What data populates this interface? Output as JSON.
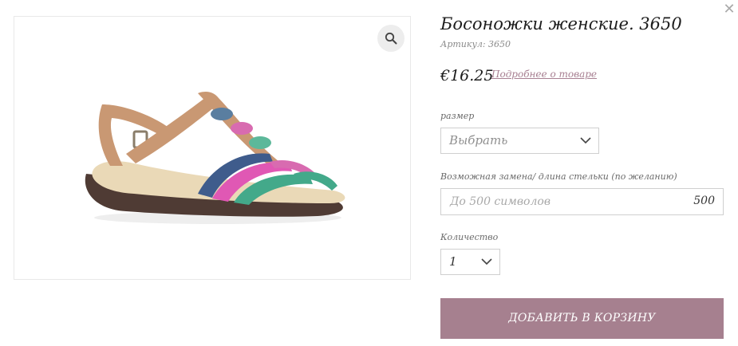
{
  "close_icon": "close-icon",
  "zoom_icon": "search-icon",
  "product": {
    "title": "Босоножки женские. 3650",
    "sku": "Артикул: 3650",
    "price": "€16.25",
    "details_link": "Подробнее о товаре"
  },
  "size": {
    "label": "размер",
    "value": "Выбрать"
  },
  "insole": {
    "label": "Возможная замена/ длина стельки (по желанию)",
    "placeholder": "До 500 символов",
    "counter": "500"
  },
  "quantity": {
    "label": "Количество",
    "value": "1"
  },
  "add_to_cart": "ДОБАВИТЬ В КОРЗИНУ",
  "colors": {
    "button": "#a6808f",
    "link": "#a88092"
  }
}
